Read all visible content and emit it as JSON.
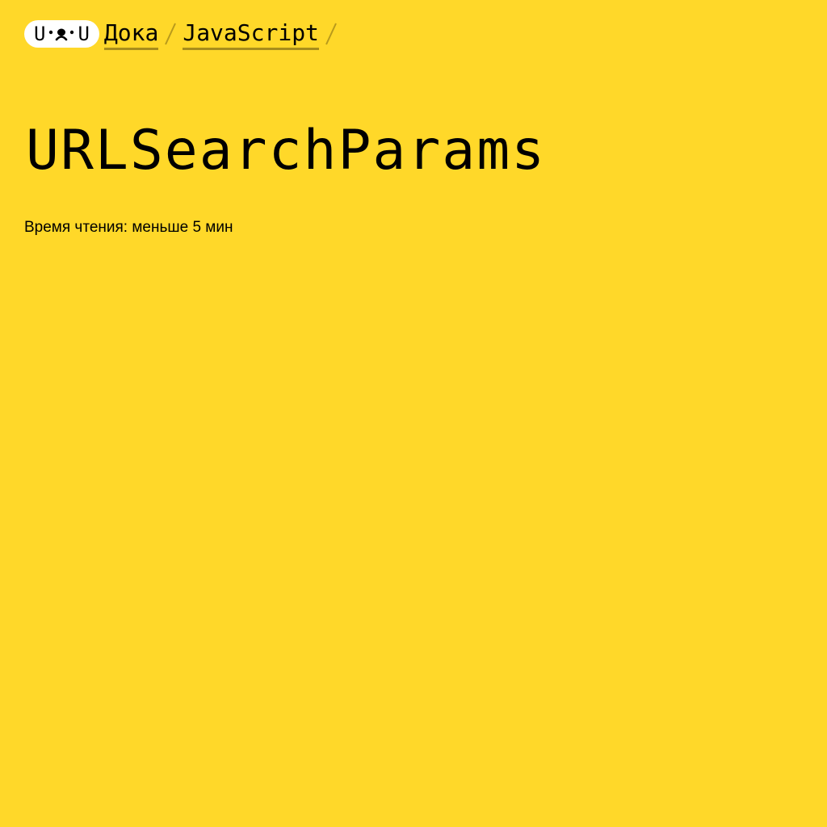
{
  "header": {
    "logo": {
      "left_glyph": "U",
      "right_glyph": "U",
      "icon": "doka-face-icon"
    },
    "breadcrumbs": [
      {
        "label": "Дока"
      },
      {
        "label": "JavaScript"
      }
    ],
    "separator_icon": "slash-separator-icon"
  },
  "article": {
    "title": "URLSearchParams",
    "reading_time": "Время чтения: меньше 5 мин"
  },
  "colors": {
    "background": "#FFD829",
    "logo_background": "#FFFFFF",
    "text": "#000000",
    "underline": "#A88D1A"
  }
}
